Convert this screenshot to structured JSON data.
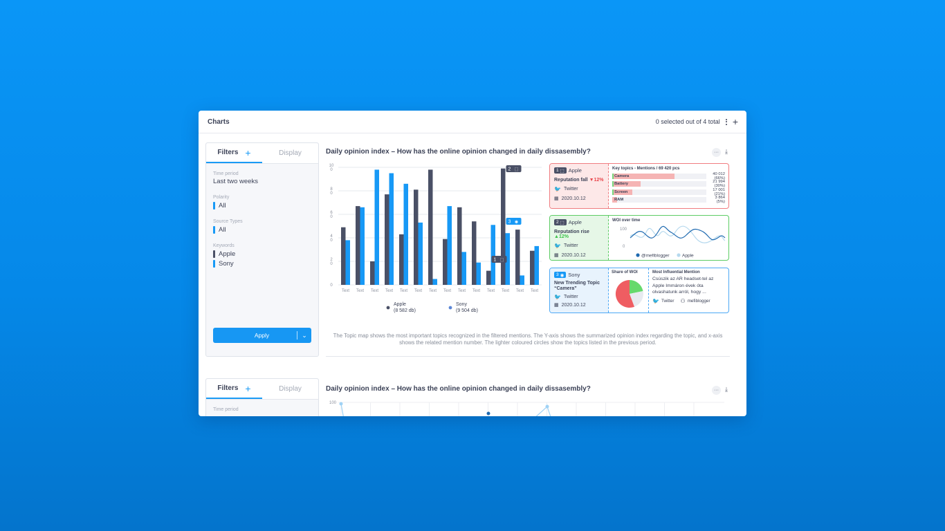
{
  "window": {
    "title": "Charts",
    "selection_status": "0 selected out of 4 total"
  },
  "panel1": {
    "tabs": {
      "filters": "Filters",
      "display": "Display"
    },
    "time_period": {
      "label": "Time period",
      "value": "Last two weeks"
    },
    "polarity": {
      "label": "Polarity",
      "value": "All"
    },
    "source_types": {
      "label": "Source Types",
      "value": "All"
    },
    "keywords": {
      "label": "Keywords",
      "items": [
        "Apple",
        "Sony"
      ]
    },
    "apply_label": "Apply"
  },
  "panel2": {
    "tabs": {
      "filters": "Filters",
      "display": "Display"
    },
    "time_period": {
      "label": "Time period"
    }
  },
  "chart1": {
    "title": "Daily opinion index – How has the online opinion changed in daily dissasembly?",
    "description": "The Topic map shows the most important topics recognized in the filtered mentions. The Y-axis shows the summarized opinion index regarding the topic, and x-axis shows the related mention number. The lighter coloured circles show the topics listed in the previous period."
  },
  "chart2": {
    "title": "Daily opinion index – How has the online opinion changed in daily dissasembly?",
    "y_top_label": "100"
  },
  "colors": {
    "apple": "#4a5066",
    "sony": "#1799f6",
    "fall": "#e9474d",
    "rise": "#3cc24a",
    "neutral_card": "#4ca8f5"
  },
  "chart_data": {
    "type": "bar",
    "categories": [
      "Text",
      "Text",
      "Text",
      "Text",
      "Text",
      "Text",
      "Text",
      "Text",
      "Text",
      "Text",
      "Text",
      "Text",
      "Text",
      "Text"
    ],
    "ytick_labels": [
      "10\n0",
      "8\n0",
      "6\n0",
      "4\n0",
      "2\n0",
      "0"
    ],
    "ylim": [
      0,
      100
    ],
    "grid": true,
    "legend_position": "bottom",
    "series": [
      {
        "name": "Apple",
        "sub": "(8 582 db)",
        "values": [
          49,
          67,
          20,
          77,
          43,
          81,
          98,
          39,
          66,
          54,
          12,
          99,
          47,
          29
        ]
      },
      {
        "name": "Sony",
        "sub": "(9 504 db)",
        "values": [
          38,
          66,
          98,
          95,
          86,
          53,
          5,
          67,
          28,
          19,
          51,
          44,
          8,
          33
        ]
      }
    ],
    "markers": [
      {
        "label": "2",
        "icon": "chart-icon",
        "category_index": 11
      },
      {
        "label": "3",
        "icon": "person-icon",
        "category_index": 11
      },
      {
        "label": "1",
        "icon": "chart-icon",
        "category_index": 10
      }
    ]
  },
  "cards": [
    {
      "num": "1",
      "brand": "Apple",
      "metric": "Reputation fall",
      "change": "12%",
      "change_arrow": "▼",
      "source": "Twitter",
      "date": "2020.10.12",
      "right_title": "Key topics - Mentions / 69 420 pcs",
      "topics": [
        {
          "name": "Camera",
          "value": "40 012 (66%)",
          "share": 0.66,
          "prev": true
        },
        {
          "name": "Battery",
          "value": "21 994 (30%)",
          "share": 0.3,
          "prev": true
        },
        {
          "name": "Screen",
          "value": "17 001 (21%)",
          "share": 0.21,
          "prev": true
        },
        {
          "name": "RAM",
          "value": "3 864 (5%)",
          "share": 0.05,
          "prev": false
        }
      ]
    },
    {
      "num": "2",
      "brand": "Apple",
      "metric": "Reputation rise",
      "change": "12%",
      "change_arrow": "▲",
      "source": "Twitter",
      "date": "2020.10.12",
      "right_title": "WOI over time",
      "y_top": "100",
      "y_bottom": "0",
      "legend": [
        "@mefiblogger",
        "Apple"
      ]
    },
    {
      "num": "3",
      "brand": "Sony",
      "metric": "New Trending Topic “Camera”",
      "source": "Twitter",
      "date": "2020.10.12",
      "mid_title": "Share of WOI",
      "right_title": "Most Influential Mention",
      "mention_text": "Csúszik az AR headset-tel az Apple Immáron évek óta olvashatunk arról, hogy ...",
      "mention_source": "Twitter",
      "mention_author": "mefiblogger"
    }
  ]
}
